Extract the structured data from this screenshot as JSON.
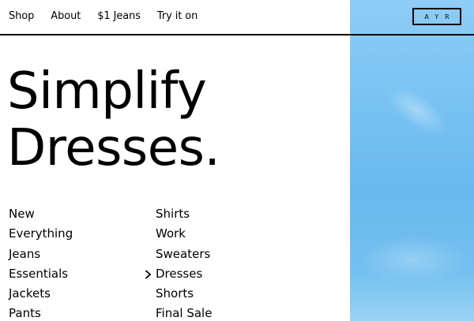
{
  "nav": {
    "items": [
      "Shop",
      "About",
      "$1 Jeans",
      "Try it on"
    ]
  },
  "brand": {
    "logo_text": "AYR"
  },
  "headline": {
    "line1": "Simplify",
    "line2": "Dresses."
  },
  "categories": {
    "left": [
      "New",
      "Everything",
      "Jeans",
      "Essentials",
      "Jackets",
      "Pants"
    ],
    "right": [
      "Shirts",
      "Work",
      "Sweaters",
      "Dresses",
      "Shorts",
      "Final Sale"
    ],
    "selected": "Dresses"
  },
  "colors": {
    "sky": "#76c1f2",
    "text": "#000000",
    "background": "#ffffff"
  },
  "icons": {
    "selected_marker": "chevron-right-icon"
  }
}
